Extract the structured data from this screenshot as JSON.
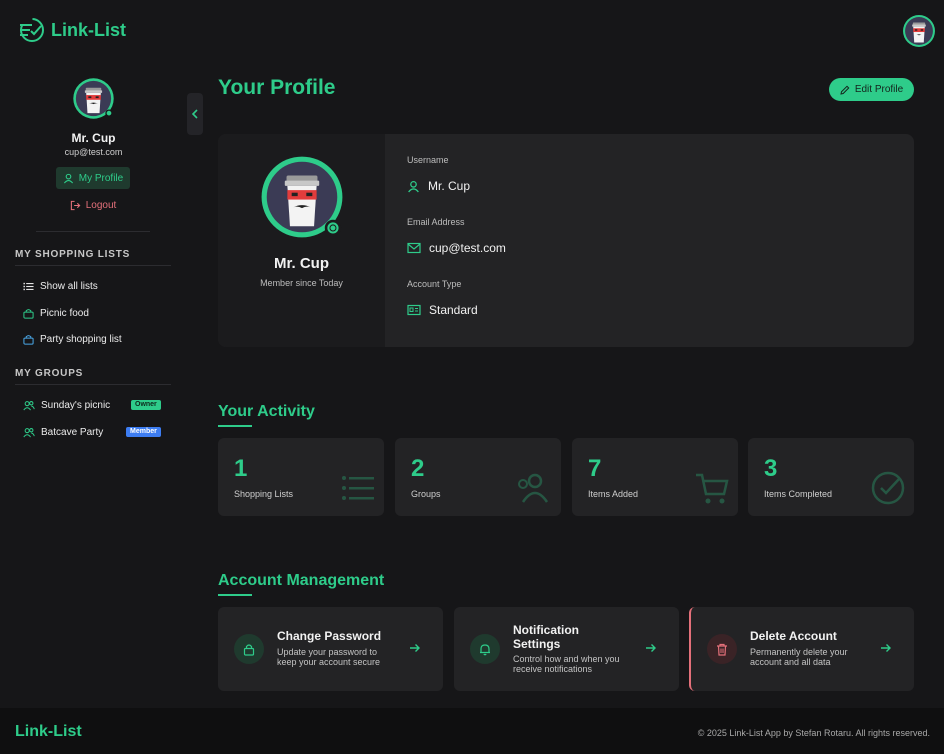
{
  "app": {
    "name": "Link-List"
  },
  "user": {
    "name": "Mr. Cup",
    "email": "cup@test.com",
    "member_since": "Member since Today"
  },
  "sidebar": {
    "my_profile": "My Profile",
    "logout": "Logout",
    "shopping_section": "MY SHOPPING LISTS",
    "shopping_items": [
      {
        "label": "Show all lists",
        "icon": "list-icon"
      },
      {
        "label": "Picnic food",
        "icon": "basket-icon"
      },
      {
        "label": "Party shopping list",
        "icon": "basket-icon"
      }
    ],
    "groups_section": "MY GROUPS",
    "groups": [
      {
        "label": "Sunday's picnic",
        "badge": "Owner",
        "badge_color": "#2ecc8a"
      },
      {
        "label": "Batcave Party",
        "badge": "Member",
        "badge_color": "#3d7df2"
      }
    ]
  },
  "profile": {
    "title": "Your Profile",
    "edit_button": "Edit Profile",
    "fields": [
      {
        "label": "Username",
        "value": "Mr. Cup",
        "icon": "user-icon"
      },
      {
        "label": "Email Address",
        "value": "cup@test.com",
        "icon": "mail-icon"
      },
      {
        "label": "Account Type",
        "value": "Standard",
        "icon": "id-card-icon"
      }
    ]
  },
  "activity": {
    "title": "Your Activity",
    "stats": [
      {
        "value": "1",
        "label": "Shopping Lists",
        "icon": "list-icon"
      },
      {
        "value": "2",
        "label": "Groups",
        "icon": "users-icon"
      },
      {
        "value": "7",
        "label": "Items Added",
        "icon": "cart-icon"
      },
      {
        "value": "3",
        "label": "Items Completed",
        "icon": "check-circle-icon"
      }
    ]
  },
  "account": {
    "title": "Account Management",
    "actions": [
      {
        "title": "Change Password",
        "desc": "Update your password to keep your account secure",
        "icon": "lock-icon"
      },
      {
        "title": "Notification Settings",
        "desc": "Control how and when you receive notifications",
        "icon": "bell-icon"
      },
      {
        "title": "Delete Account",
        "desc": "Permanently delete your account and all data",
        "icon": "trash-icon"
      }
    ]
  },
  "footer": {
    "logo": "Link-List",
    "copyright": "© 2025 Link-List App by Stefan Rotaru. All rights reserved."
  },
  "colors": {
    "accent": "#2ecc8a",
    "danger": "#e4707a",
    "member_badge": "#3d7df2",
    "background": "#161618",
    "card": "#232325"
  }
}
